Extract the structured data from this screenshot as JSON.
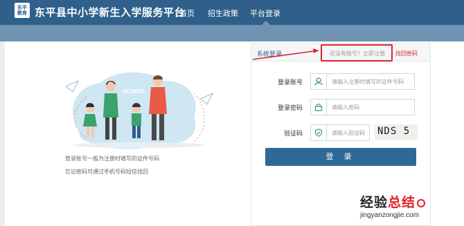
{
  "header": {
    "logo_line1": "东平",
    "logo_line2": "教育",
    "site_title": "东平县中小学新生入学服务平台",
    "nav": [
      {
        "label": "首页"
      },
      {
        "label": "招生政策"
      },
      {
        "label": "平台登录"
      }
    ],
    "active_nav": "平台登录"
  },
  "illustration": {
    "sign_text": "SCHOOL"
  },
  "notes": {
    "line1": "登录账号一般为注册时填写的证件号码",
    "line2": "忘记密码可通过手机号码短信找回"
  },
  "login_panel": {
    "title": "系统登录",
    "register_prompt": "还没有账号？立即注册",
    "forgot_link": "找回密码",
    "account_label": "登录账号",
    "account_placeholder": "请输入注册时填写的证件号码",
    "password_label": "登录密码",
    "password_placeholder": "请输入密码",
    "captcha_label": "验证码",
    "captcha_placeholder": "请输入验证码",
    "captcha_text": "NDS 5",
    "login_button": "登 录"
  },
  "watermark": {
    "text_black": "经验",
    "text_red": "总结",
    "url": "jingyanzongjie.com"
  },
  "colors": {
    "header": "#2f5f8a",
    "subbar": "#6f94b3",
    "highlight": "#e0202a",
    "button": "#2f6a96"
  }
}
